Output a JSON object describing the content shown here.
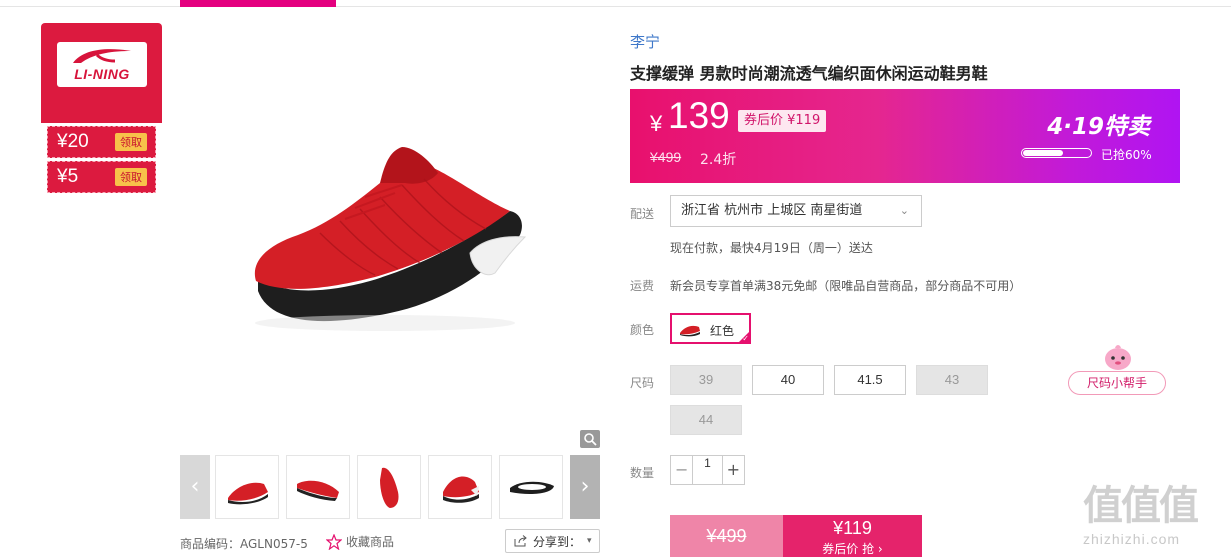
{
  "store": {
    "brand_logo_text": "LI-NING",
    "coupons": [
      {
        "amount": "¥20",
        "action": "领取"
      },
      {
        "amount": "¥5",
        "action": "领取"
      }
    ]
  },
  "gallery": {
    "thumbnail_count": 5,
    "prev_arrow": "‹",
    "next_arrow": "›"
  },
  "product_meta": {
    "code_label": "商品编码：AGLN057-5",
    "favorite_label": "收藏商品",
    "share_label": "分享到："
  },
  "product": {
    "brand": "李宁",
    "title": "支撑缓弹 男款时尚潮流透气编织面休闲运动鞋男鞋"
  },
  "price": {
    "currency": "¥",
    "current": "139",
    "after_coupon": "券后价 ¥119",
    "original": "¥499",
    "discount": "2.4折",
    "promo_title": "4·19特卖",
    "sold_percent": 60,
    "sold_label": "已抢60%",
    "colors": {
      "start": "#e8106d",
      "end": "#b014f2"
    }
  },
  "delivery": {
    "label": "配送",
    "address": "浙江省 杭州市 上城区 南星街道",
    "note": "现在付款，最快4月19日（周一）送达"
  },
  "shipping": {
    "label": "运费",
    "note": "新会员专享首单满38元免邮（限唯品自营商品，部分商品不可用）"
  },
  "color": {
    "label": "颜色",
    "selected": "红色"
  },
  "sizes": {
    "label": "尺码",
    "options": [
      {
        "value": "39",
        "available": false
      },
      {
        "value": "40",
        "available": true
      },
      {
        "value": "41.5",
        "available": true
      },
      {
        "value": "43",
        "available": false
      },
      {
        "value": "44",
        "available": false
      }
    ],
    "helper_label": "尺码小帮手"
  },
  "quantity": {
    "label": "数量",
    "value": "1",
    "minus": "−",
    "plus": "+"
  },
  "buy": {
    "original_price": "¥499",
    "coupon_price": "¥119",
    "action_label": "券后价 抢 ›"
  },
  "watermark": {
    "chars": "值值值",
    "url": "zhizhizhi.com"
  }
}
